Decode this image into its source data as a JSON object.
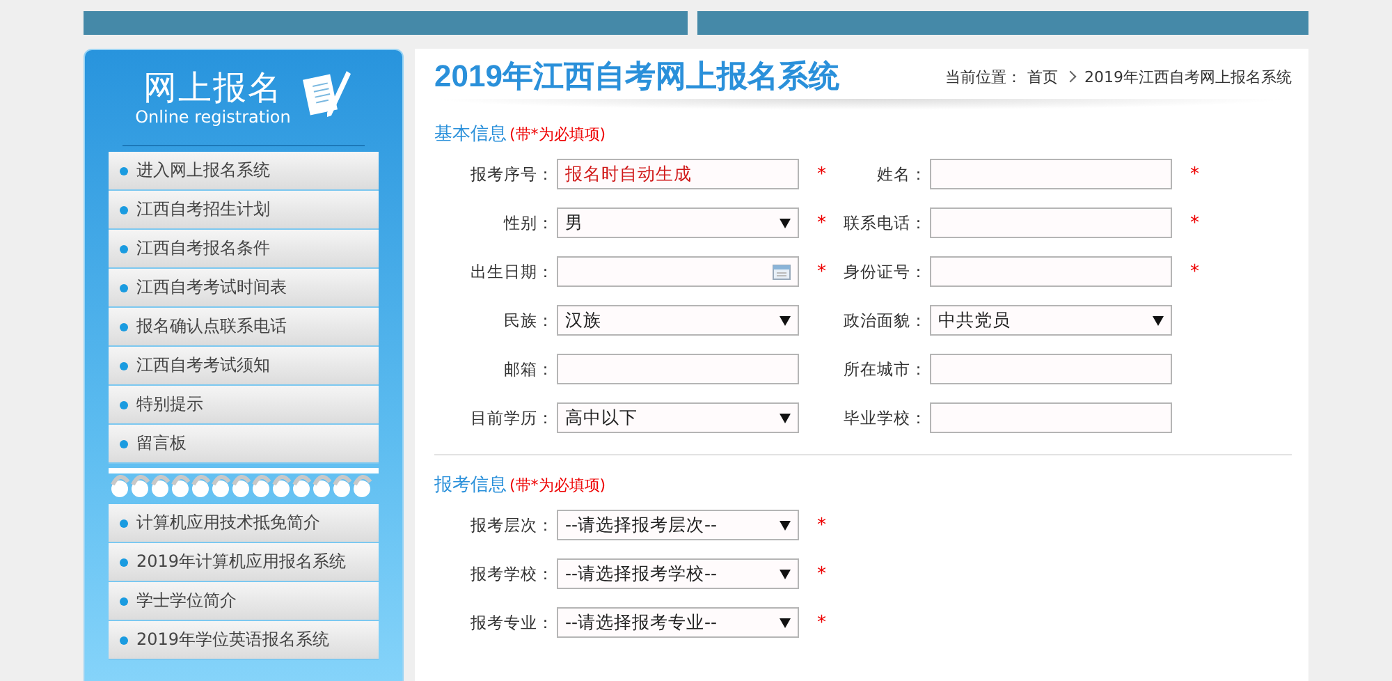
{
  "sidebar": {
    "title": "网上报名",
    "subtitle": "Online registration",
    "menu_top": [
      {
        "label": "进入网上报名系统"
      },
      {
        "label": "江西自考招生计划"
      },
      {
        "label": "江西自考报名条件"
      },
      {
        "label": "江西自考考试时间表"
      },
      {
        "label": "报名确认点联系电话"
      },
      {
        "label": "江西自考考试须知"
      },
      {
        "label": "特别提示"
      },
      {
        "label": "留言板"
      }
    ],
    "menu_bottom": [
      {
        "label": "计算机应用技术抵免简介"
      },
      {
        "label": "2019年计算机应用报名系统"
      },
      {
        "label": "学士学位简介"
      },
      {
        "label": "2019年学位英语报名系统"
      }
    ]
  },
  "main": {
    "title": "2019年江西自考网上报名系统",
    "breadcrumb": {
      "prefix": "当前位置：",
      "items": [
        "首页",
        "2019年江西自考网上报名系统"
      ]
    },
    "sections": [
      {
        "title": "基本信息",
        "note": "(带*为必填项)",
        "rows": [
          [
            {
              "label": "报考序号：",
              "kind": "auto",
              "value": "报名时自动生成",
              "asterisk": "*"
            },
            {
              "label": "姓名：",
              "kind": "text",
              "asterisk": "*"
            }
          ],
          [
            {
              "label": "性别：",
              "kind": "select",
              "value": "男",
              "asterisk": "*"
            },
            {
              "label": "联系电话：",
              "kind": "text",
              "asterisk": "*"
            }
          ],
          [
            {
              "label": "出生日期：",
              "kind": "date",
              "asterisk": "*"
            },
            {
              "label": "身份证号：",
              "kind": "text",
              "asterisk": "*"
            }
          ],
          [
            {
              "label": "民族：",
              "kind": "select",
              "value": "汉族"
            },
            {
              "label": "政治面貌：",
              "kind": "select",
              "value": "中共党员"
            }
          ],
          [
            {
              "label": "邮箱：",
              "kind": "text"
            },
            {
              "label": "所在城市：",
              "kind": "text"
            }
          ],
          [
            {
              "label": "目前学历：",
              "kind": "select",
              "value": "高中以下"
            },
            {
              "label": "毕业学校：",
              "kind": "text"
            }
          ]
        ]
      },
      {
        "title": "报考信息",
        "note": "(带*为必填项)",
        "rows": [
          [
            {
              "label": "报考层次：",
              "kind": "select",
              "value": "--请选择报考层次--",
              "asterisk": "*"
            }
          ],
          [
            {
              "label": "报考学校：",
              "kind": "select",
              "value": "--请选择报考学校--",
              "asterisk": "*"
            }
          ],
          [
            {
              "label": "报考专业：",
              "kind": "select",
              "value": "--请选择报考专业--",
              "asterisk": "*"
            }
          ]
        ]
      }
    ]
  }
}
